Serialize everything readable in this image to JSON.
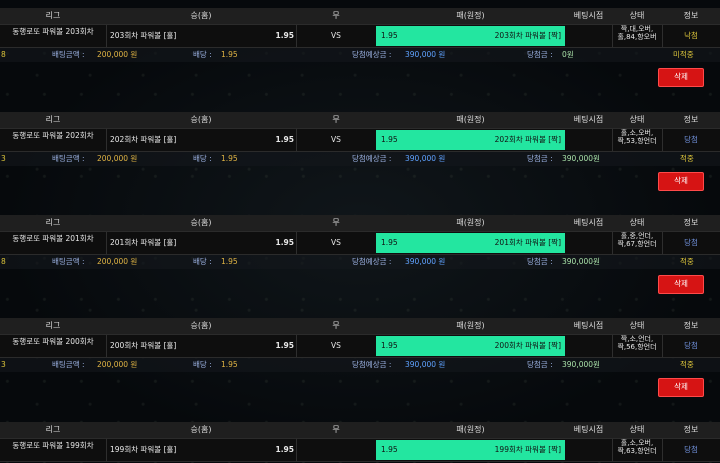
{
  "columns": [
    "리그",
    "승(홈)",
    "무",
    "패(원정)",
    "베팅시점",
    "상태",
    "정보"
  ],
  "labels": {
    "bet_amount": "배팅금액 :",
    "odds": "배당 :",
    "expected": "당첨예상금 :",
    "win_amount": "당첨금 :",
    "delete": "삭제"
  },
  "bets": [
    {
      "league": "동행로또 파워볼 203회차",
      "home": "203회차 파워볼 [홀]",
      "home_odd": "1.95",
      "draw": "VS",
      "away_odd": "1.95",
      "away": "203회차 파워볼 [짝]",
      "status": "짝,대,오버,홀,84,항오버",
      "info": "낙첨",
      "index": "8",
      "bet_amount": "200,000 원",
      "odds": "1.95",
      "expected": "390,000 원",
      "win_amount": "0원",
      "result": "미적중"
    },
    {
      "league": "동행로또 파워볼 202회차",
      "home": "202회차 파워볼 [홀]",
      "home_odd": "1.95",
      "draw": "VS",
      "away_odd": "1.95",
      "away": "202회차 파워볼 [짝]",
      "status": "홀,소,오버,짝,53,항언더",
      "info": "당첨",
      "index": "3",
      "bet_amount": "200,000 원",
      "odds": "1.95",
      "expected": "390,000 원",
      "win_amount": "390,000원",
      "result": "적중"
    },
    {
      "league": "동행로또 파워볼 201회차",
      "home": "201회차 파워볼 [홀]",
      "home_odd": "1.95",
      "draw": "VS",
      "away_odd": "1.95",
      "away": "201회차 파워볼 [짝]",
      "status": "홀,중,언더,짝,67,항언더",
      "info": "당첨",
      "index": "8",
      "bet_amount": "200,000 원",
      "odds": "1.95",
      "expected": "390,000 원",
      "win_amount": "390,000원",
      "result": "적중"
    },
    {
      "league": "동행로또 파워볼 200회차",
      "home": "200회차 파워볼 [홀]",
      "home_odd": "1.95",
      "draw": "VS",
      "away_odd": "1.95",
      "away": "200회차 파워볼 [짝]",
      "status": "짝,소,언더,짝,56,항언더",
      "info": "당첨",
      "index": "3",
      "bet_amount": "200,000 원",
      "odds": "1.95",
      "expected": "390,000 원",
      "win_amount": "390,000원",
      "result": "적중"
    },
    {
      "league": "동행로또 파워볼 199회차",
      "home": "199회차 파워볼 [홀]",
      "home_odd": "1.95",
      "draw": "",
      "away_odd": "1.95",
      "away": "199회차 파워볼 [짝]",
      "status": "홀,소,오버,짝,63,항언더",
      "info": "당첨"
    }
  ]
}
